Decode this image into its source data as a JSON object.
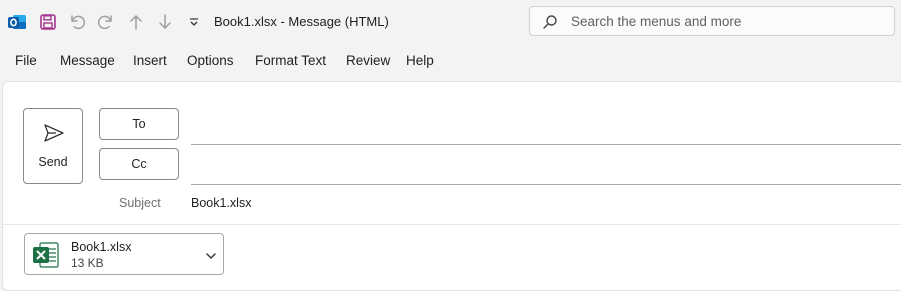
{
  "window": {
    "title": "Book1.xlsx  -  Message (HTML)",
    "app_icon": "outlook-icon",
    "quick_access": [
      "save-icon",
      "undo-icon",
      "redo-icon",
      "up-arrow-icon",
      "down-arrow-icon",
      "customize-chevron-icon"
    ]
  },
  "search": {
    "placeholder": "Search the menus and more",
    "icon": "search-icon"
  },
  "menu": [
    "File",
    "Message",
    "Insert",
    "Options",
    "Format Text",
    "Review",
    "Help"
  ],
  "compose": {
    "send_label": "Send",
    "to_label": "To",
    "cc_label": "Cc",
    "to_value": "",
    "cc_value": "",
    "subject_label": "Subject",
    "subject_value": "Book1.xlsx"
  },
  "attachment": {
    "name": "Book1.xlsx",
    "size": "13 KB",
    "icon": "excel-file-icon"
  },
  "colors": {
    "save_icon": "#a4338f",
    "excel_green": "#1d7044",
    "outlook_blue": "#0f6cbd"
  }
}
